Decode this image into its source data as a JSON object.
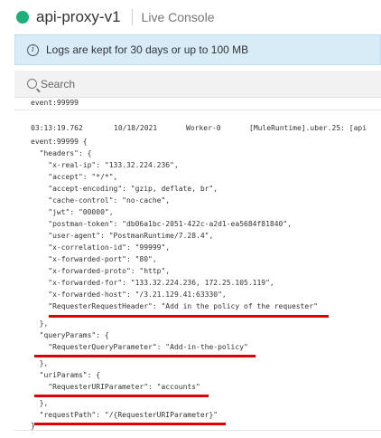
{
  "header": {
    "app_name": "api-proxy-v1",
    "mode_label": "Live Console",
    "status_color": "#1bb07b"
  },
  "info_bar": {
    "icon": "info-icon",
    "text": "Logs are kept for 30 days or up to 100 MB"
  },
  "search": {
    "icon": "search-icon",
    "placeholder": "Search"
  },
  "log": {
    "previous_entry_tail": "event:99999",
    "entry": {
      "time": "03:13:19.762",
      "date": "10/18/2021",
      "worker": "Worker-0",
      "thread": "[MuleRuntime].uber.25: [api"
    },
    "lines": [
      "event:99999 {",
      "  \"headers\": {",
      "    \"x-real-ip\": \"133.32.224.236\",",
      "    \"accept\": \"*/*\",",
      "    \"accept-encoding\": \"gzip, deflate, br\",",
      "    \"cache-control\": \"no-cache\",",
      "    \"jwt\": \"00000\",",
      "    \"postman-token\": \"db06a1bc-2051-422c-a2d1-ea5684f81840\",",
      "    \"user-agent\": \"PostmanRuntime/7.28.4\",",
      "    \"x-correlation-id\": \"99999\",",
      "    \"x-forwarded-port\": \"80\",",
      "    \"x-forwarded-proto\": \"http\",",
      "    \"x-forwarded-for\": \"133.32.224.236, 172.25.105.119\",",
      "    \"x-forwarded-host\": \"/3.21.129.41:63330\",",
      "    \"RequesterRequestHeader\": \"Add in the policy of the requester\"",
      "  },",
      "  \"queryParams\": {",
      "    \"RequesterQueryParameter\": \"Add-in-the-policy\"",
      "  },",
      "  \"uriParams\": {",
      "    \"RequesterURIParameter\": \"accounts\"",
      "  },",
      "  \"requestPath\": \"/{RequesterURIParameter}\"",
      "}"
    ],
    "highlight_color": "#e00000"
  }
}
